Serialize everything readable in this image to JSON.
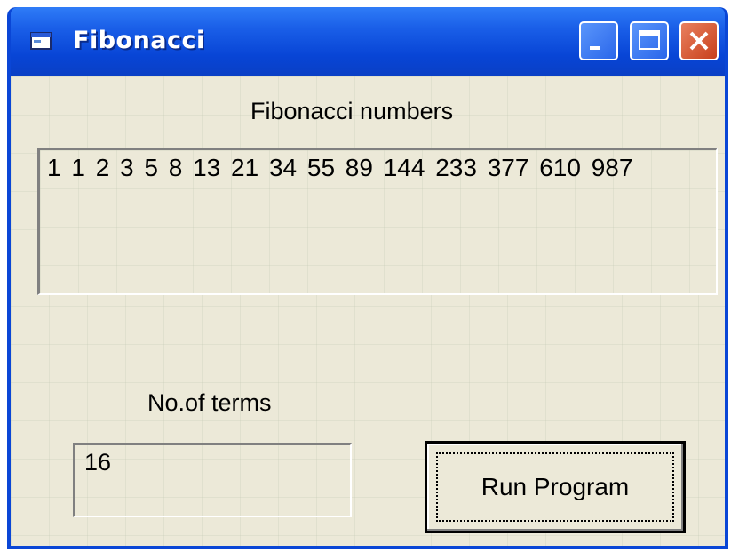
{
  "window": {
    "title": "Fibonacci",
    "icon": "app-window-icon"
  },
  "main": {
    "heading": "Fibonacci numbers",
    "output": "1  1  2  3  5  8  13  21  34  55  89  144  233  377  610  987",
    "terms_label": "No.of terms",
    "terms_value": "16",
    "run_button_label": "Run Program"
  },
  "colors": {
    "titlebar": "#0a46d6",
    "client_background": "#ece9d8",
    "close_button": "#c8401c"
  }
}
